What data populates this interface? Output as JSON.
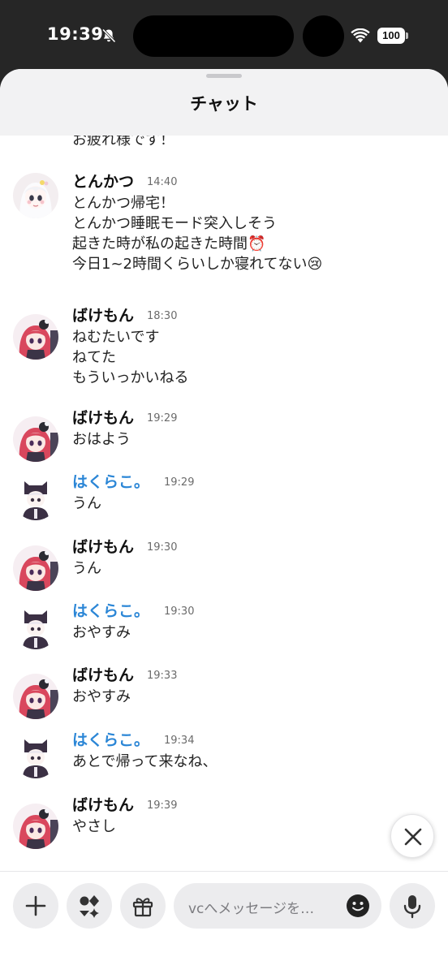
{
  "status_bar": {
    "time": "19:39",
    "battery": "100"
  },
  "header": {
    "title": "チャット"
  },
  "previous_message_tail": "お疲れ様です！",
  "messages": [
    {
      "name": "とんかつ",
      "time": "14:40",
      "lines": [
        "とんかつ帰宅！",
        "とんかつ睡眠モード突入しそう",
        "起きた時が私の起きた時間⏰",
        "今日1~2時間くらいしか寝れてない😢"
      ]
    },
    {
      "name": "ばけもん",
      "time": "18:30",
      "lines": [
        "ねむたいです",
        "ねてた",
        "もういっかいねる"
      ]
    },
    {
      "name": "ばけもん",
      "time": "19:29",
      "lines": [
        "おはよう"
      ]
    },
    {
      "name": "はくらこ。",
      "time": "19:29",
      "lines": [
        "うん"
      ]
    },
    {
      "name": "ばけもん",
      "time": "19:30",
      "lines": [
        "うん"
      ]
    },
    {
      "name": "はくらこ。",
      "time": "19:30",
      "lines": [
        "おやすみ"
      ]
    },
    {
      "name": "ばけもん",
      "time": "19:33",
      "lines": [
        "おやすみ"
      ]
    },
    {
      "name": "はくらこ。",
      "time": "19:34",
      "lines": [
        "あとで帰って来なね、"
      ]
    },
    {
      "name": "ばけもん",
      "time": "19:39",
      "lines": [
        "やさし"
      ]
    }
  ],
  "composer": {
    "placeholder": "vcへメッセージを…"
  },
  "icons": [
    "bell-slash-icon",
    "wifi-icon",
    "close-icon",
    "plus-icon",
    "apps-icon",
    "gift-icon",
    "emoji-icon",
    "microphone-icon"
  ],
  "colors": {
    "accent_name": "#2b86d6",
    "header_bg": "#f2f2f3",
    "button_bg": "#ececee"
  }
}
